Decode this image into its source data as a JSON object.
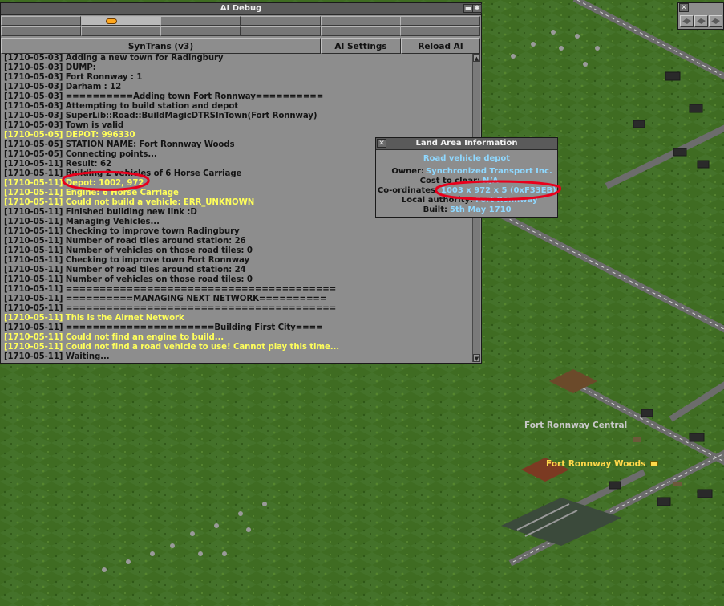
{
  "ai_debug": {
    "title": "AI Debug",
    "tabs_row1": 6,
    "tabs_row2": 6,
    "active_tab": 1,
    "buttons": {
      "ai_name": "SynTrans (v3)",
      "settings": "AI Settings",
      "reload": "Reload AI"
    },
    "log": [
      {
        "text": "[1710-05-03] Adding a new town for Radingbury",
        "hl": false
      },
      {
        "text": "[1710-05-03] DUMP:",
        "hl": false
      },
      {
        "text": "[1710-05-03] Fort Ronnway : 1",
        "hl": false
      },
      {
        "text": "[1710-05-03] Darham : 12",
        "hl": false
      },
      {
        "text": "[1710-05-03] ==========Adding town Fort Ronnway==========",
        "hl": false
      },
      {
        "text": "[1710-05-03] Attempting to build station and depot",
        "hl": false
      },
      {
        "text": "[1710-05-03] SuperLib::Road::BuildMagicDTRSInTown(Fort Ronnway)",
        "hl": false
      },
      {
        "text": "[1710-05-03] Town is valid",
        "hl": false
      },
      {
        "text": "[1710-05-05] DEPOT: 996330",
        "hl": true
      },
      {
        "text": "[1710-05-05] STATION NAME: Fort Ronnway Woods",
        "hl": false
      },
      {
        "text": "[1710-05-05] Connecting points...",
        "hl": false
      },
      {
        "text": "[1710-05-11] Result: 62",
        "hl": false
      },
      {
        "text": "[1710-05-11] Building 2 vehicles of 6 Horse Carriage",
        "hl": false
      },
      {
        "text": "[1710-05-11] Depot: 1002, 972",
        "hl": true
      },
      {
        "text": "[1710-05-11] Engine: 6 Horse Carriage",
        "hl": true
      },
      {
        "text": "[1710-05-11] Could not build a vehicle: ERR_UNKNOWN",
        "hl": true
      },
      {
        "text": "[1710-05-11] Finished building new link :D",
        "hl": false
      },
      {
        "text": "[1710-05-11] Managing Vehicles...",
        "hl": false
      },
      {
        "text": "[1710-05-11] Checking to improve town Radingbury",
        "hl": false
      },
      {
        "text": "[1710-05-11] Number of road tiles around station: 26",
        "hl": false
      },
      {
        "text": "[1710-05-11] Number of vehicles on those road tiles: 0",
        "hl": false
      },
      {
        "text": "[1710-05-11] Checking to improve town Fort Ronnway",
        "hl": false
      },
      {
        "text": "[1710-05-11] Number of road tiles around station: 24",
        "hl": false
      },
      {
        "text": "[1710-05-11] Number of vehicles on those road tiles: 0",
        "hl": false
      },
      {
        "text": "[1710-05-11] ========================================",
        "hl": false
      },
      {
        "text": "[1710-05-11] ==========MANAGING NEXT NETWORK==========",
        "hl": false
      },
      {
        "text": "[1710-05-11] ========================================",
        "hl": false
      },
      {
        "text": "[1710-05-11] This is the Airnet Network",
        "hl": true
      },
      {
        "text": "[1710-05-11] ======================Building First City====",
        "hl": false
      },
      {
        "text": "[1710-05-11] Could not find an engine to build...",
        "hl": true
      },
      {
        "text": "[1710-05-11] Could not find a road vehicle to use! Cannot play this time...",
        "hl": true
      },
      {
        "text": "[1710-05-11] Waiting...",
        "hl": false
      }
    ]
  },
  "land_info": {
    "title": "Land Area Information",
    "type": "Road vehicle depot",
    "owner_label": "Owner:",
    "owner": "Synchronized Transport Inc.",
    "cost_label": "Cost to clear:",
    "cost": "N/A",
    "coords_label": "Co-ordinates:",
    "coords": "1003 x 972 x 5 (0xF33EB)",
    "authority_label": "Local authority:",
    "authority": "Fort Ronnway",
    "built_label": "Built:",
    "built": "5th May 1710"
  },
  "map": {
    "town_labels": [
      {
        "text": "Fort Ronnway Central",
        "color": "#c8c8c8"
      },
      {
        "text": "Fort Ronnway Woods",
        "color": "#ffd84a"
      }
    ]
  },
  "colors": {
    "grass": "#3d6a20",
    "panel": "#8d8d8d",
    "highlight_text": "#ffff5a",
    "value_text": "#8fd8ff",
    "annotation": "#e8001c"
  }
}
